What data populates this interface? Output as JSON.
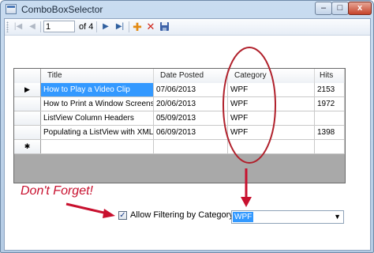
{
  "window": {
    "title": "ComboBoxSelector",
    "min_label": "–",
    "max_label": "□",
    "close_label": "x"
  },
  "toolbar": {
    "first_glyph": "|◀",
    "prev_glyph": "◀",
    "position_value": "1",
    "count_text": "of 4",
    "next_glyph": "▶",
    "last_glyph": "▶|",
    "add_glyph": "✚",
    "delete_glyph": "✕"
  },
  "grid": {
    "columns": [
      "Title",
      "Date Posted",
      "Category",
      "Hits"
    ],
    "current_row_marker": "▶",
    "new_row_marker": "✱",
    "rows": [
      {
        "title": "How to Play a Video Clip",
        "date": "07/06/2013",
        "category": "WPF",
        "hits": "2153"
      },
      {
        "title": "How to Print a Window Screensho...",
        "date": "20/06/2013",
        "category": "WPF",
        "hits": "1972"
      },
      {
        "title": "ListView Column Headers",
        "date": "05/09/2013",
        "category": "WPF",
        "hits": ""
      },
      {
        "title": "Populating a ListView with XML D...",
        "date": "06/09/2013",
        "category": "WPF",
        "hits": "1398"
      }
    ]
  },
  "annotation": {
    "text": "Don't Forget!",
    "color": "#c8102e"
  },
  "filter": {
    "checkbox_label": "Allow Filtering by Category",
    "checked": true,
    "check_glyph": "✓",
    "combo_value": "WPF",
    "combo_arrow": "▼"
  },
  "colors": {
    "selection": "#3399ff",
    "annotation_red": "#c8102e"
  }
}
